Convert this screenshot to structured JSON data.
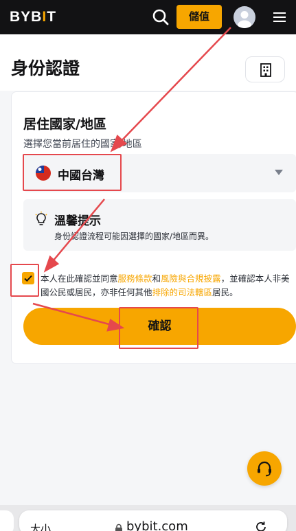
{
  "nav": {
    "logo_main": "BYB",
    "logo_accent": "I",
    "logo_end": "T",
    "deposit_label": "儲值",
    "icons": [
      "search-icon",
      "avatar",
      "hamburger-icon"
    ]
  },
  "header": {
    "title": "身份認證",
    "icons": [
      "building-icon"
    ]
  },
  "form": {
    "section_title": "居住國家/地區",
    "section_subtitle": "選擇您當前居住的國家/地區",
    "country_value": "中國台灣",
    "tip_title": "溫馨提示",
    "tip_body": "身份認證流程可能因選擇的國家/地區而異。",
    "agreement": {
      "checked": true,
      "text_1": "本人在此確認並同意",
      "link_terms": "服務條款",
      "text_2": "和",
      "link_risk": "風險與合規披露",
      "text_3": "，並確認本人非美國公民或居民，亦非任何其他",
      "link_excluded": "排除的司法轄區",
      "text_4": "居民。"
    },
    "confirm_label": "確認"
  },
  "browser": {
    "text_size": "大小",
    "url": "bybit.com"
  },
  "colors": {
    "brand": "#f7a600",
    "nav_bg": "#121214",
    "annotation": "#e5484d"
  }
}
